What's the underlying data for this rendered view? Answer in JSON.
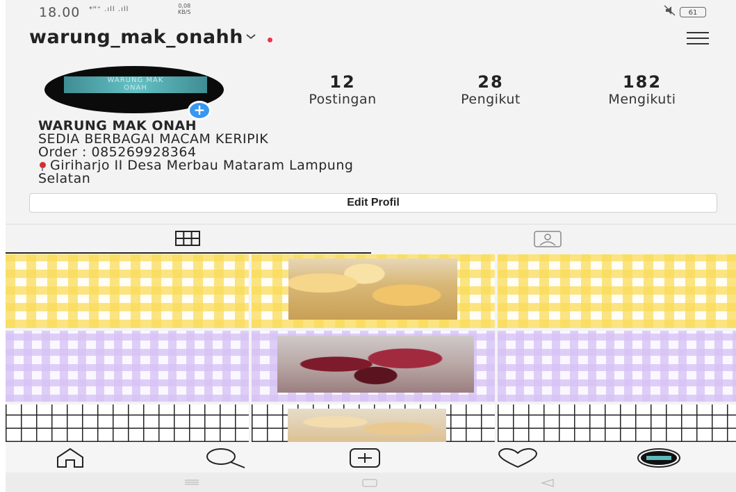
{
  "status_bar": {
    "time": "18.00",
    "network": "*ᴴ⁺ .ıll .ıll",
    "speed": "0,08\nKB/S",
    "battery": "61"
  },
  "header": {
    "username": "warung_mak_onahh"
  },
  "profile": {
    "avatar_text": "WARUNG MAK\nONAH",
    "add_symbol": "+",
    "stats": [
      {
        "value": "12",
        "label": "Postingan"
      },
      {
        "value": "28",
        "label": "Pengikut"
      },
      {
        "value": "182",
        "label": "Mengikuti"
      }
    ],
    "bio": {
      "name": "WARUNG MAK ONAH",
      "line1": "SEDIA BERBAGAI MACAM KERIPIK",
      "line2": "Order : 085269928364",
      "location_line1": "Giriharjo II Desa Merbau Mataram Lampung",
      "location_line2": "Selatan"
    },
    "edit_button": "Edit Profil"
  },
  "tabs": [
    {
      "icon": "grid-icon",
      "active": true
    },
    {
      "icon": "tagged-person-icon",
      "active": false
    }
  ],
  "bottom_nav": [
    "home-icon",
    "search-icon",
    "add-post-icon",
    "heart-icon",
    "profile-avatar-icon"
  ],
  "colors": {
    "accent_blue": "#3897f0",
    "notification_red": "#e8354b",
    "text": "#262626"
  }
}
